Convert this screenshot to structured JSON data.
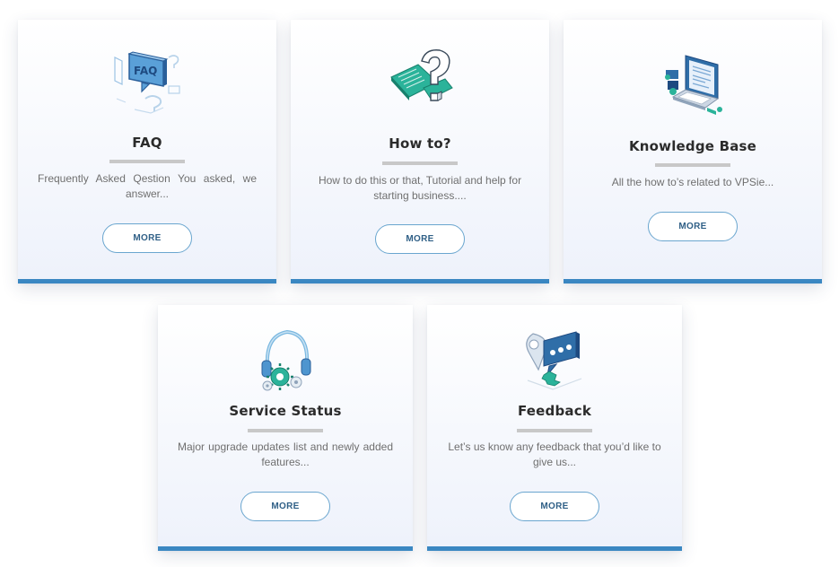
{
  "colors": {
    "accent": "#3a87c2",
    "divider": "#c8c8c8",
    "button_border": "#6aa6cf",
    "teal": "#2bb39a"
  },
  "cards": [
    {
      "icon": "faq-icon",
      "title": "FAQ",
      "icon_text": "FAQ",
      "description": "Frequently Asked Qestion You asked, we answer...",
      "button": "MORE"
    },
    {
      "icon": "question-document-icon",
      "title": "How to?",
      "description": "How to do this or that, Tutorial and help for starting business....",
      "button": "MORE"
    },
    {
      "icon": "laptop-knowledge-icon",
      "title": "Knowledge Base",
      "description": "All the how to’s related to VPSie...",
      "button": "MORE"
    },
    {
      "icon": "headset-gears-icon",
      "title": "Service Status",
      "description": "Major upgrade updates list and newly added features...",
      "button": "MORE"
    },
    {
      "icon": "chat-bubble-icon",
      "title": "Feedback",
      "description": "Let’s us know any feedback that you’d like to give us...",
      "button": "MORE"
    }
  ]
}
